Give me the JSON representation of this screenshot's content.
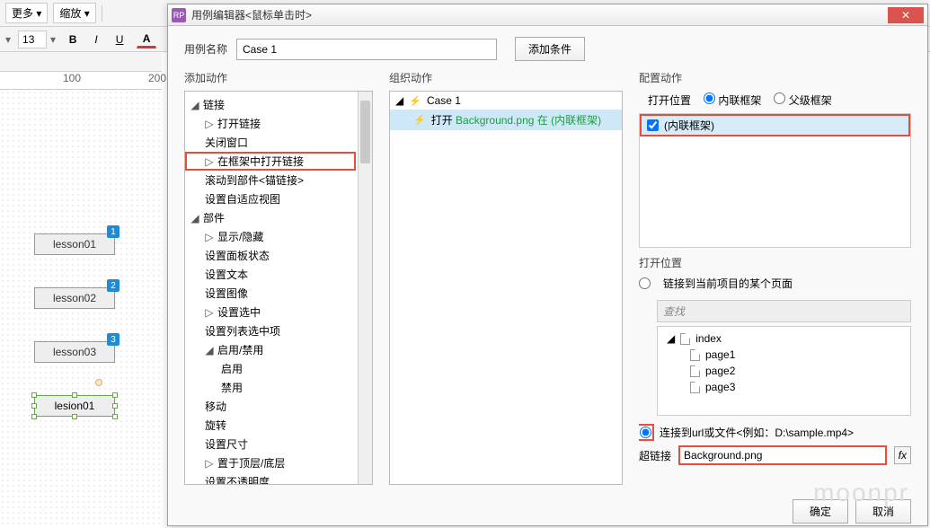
{
  "toolbar": {
    "more": "更多",
    "zoom": "缩放",
    "fontsize": "13"
  },
  "ruler": {
    "t1": "100",
    "t2": "200"
  },
  "canvas": {
    "boxes": [
      {
        "label": "lesson01",
        "badge": "1"
      },
      {
        "label": "lesson02",
        "badge": "2"
      },
      {
        "label": "lesson03",
        "badge": "3"
      }
    ],
    "selected": {
      "label": "lesion01"
    }
  },
  "dialog": {
    "title": "用例编辑器<鼠标单击时>",
    "caseLabel": "用例名称",
    "caseName": "Case 1",
    "addCondition": "添加条件",
    "col1Title": "添加动作",
    "col2Title": "组织动作",
    "col3Title": "配置动作",
    "ok": "确定",
    "cancel": "取消"
  },
  "actionTree": {
    "g1": "链接",
    "g1_items": [
      "打开链接",
      "关闭窗口",
      "在框架中打开链接",
      "滚动到部件<锚链接>",
      "设置自适应视图"
    ],
    "g2": "部件",
    "g2_items": [
      "显示/隐藏",
      "设置面板状态",
      "设置文本",
      "设置图像",
      "设置选中",
      "设置列表选中项"
    ],
    "g2_sub": "启用/禁用",
    "g2_sub_items": [
      "启用",
      "禁用"
    ],
    "g2_tail": [
      "移动",
      "旋转",
      "设置尺寸",
      "置于顶层/底层",
      "设置不透明度"
    ]
  },
  "organize": {
    "caseLabel": "Case 1",
    "action_prefix": "打开 ",
    "action_link": "Background.png 在 (内联框架)"
  },
  "config": {
    "openPosLabel": "打开位置",
    "opt_inline": "内联框架",
    "opt_parent": "父级框架",
    "inline_item": "(内联框架)",
    "openPos2": "打开位置",
    "radio_link_page": "链接到当前项目的某个页面",
    "search_placeholder": "查找",
    "pages": {
      "root": "index",
      "children": [
        "page1",
        "page2",
        "page3"
      ]
    },
    "radio_link_url": "连接到url或文件<例如：D:\\sample.mp4>",
    "hyperlinkLabel": "超链接",
    "hyperlinkValue": "Background.png",
    "fx": "fx"
  },
  "watermark": "moonpr"
}
